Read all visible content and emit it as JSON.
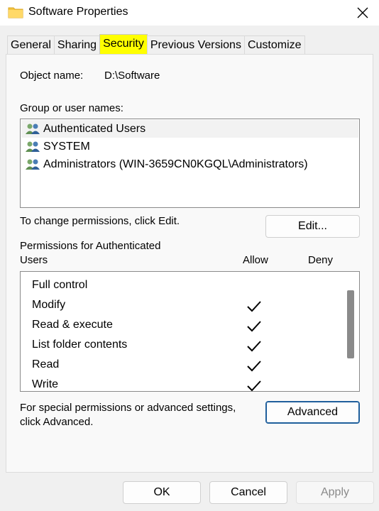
{
  "window": {
    "title": "Software Properties"
  },
  "tabs": [
    {
      "label": "General"
    },
    {
      "label": "Sharing"
    },
    {
      "label": "Security"
    },
    {
      "label": "Previous Versions"
    },
    {
      "label": "Customize"
    }
  ],
  "object": {
    "label": "Object name:",
    "value": "D:\\Software"
  },
  "groups": {
    "label": "Group or user names:",
    "items": [
      {
        "name": "Authenticated Users"
      },
      {
        "name": "SYSTEM"
      },
      {
        "name": "Administrators (WIN-3659CN0KGQL\\Administrators)"
      }
    ]
  },
  "edit": {
    "hint": "To change permissions, click Edit.",
    "button": "Edit..."
  },
  "permissions": {
    "title_line1": "Permissions for Authenticated",
    "title_line2": "Users",
    "allow_label": "Allow",
    "deny_label": "Deny",
    "rows": [
      {
        "name": "Full control",
        "allow": false
      },
      {
        "name": "Modify",
        "allow": true
      },
      {
        "name": "Read & execute",
        "allow": true
      },
      {
        "name": "List folder contents",
        "allow": true
      },
      {
        "name": "Read",
        "allow": true
      },
      {
        "name": "Write",
        "allow": true
      }
    ]
  },
  "advanced": {
    "hint_line1": "For special permissions or advanced settings,",
    "hint_line2": "click Advanced.",
    "button": "Advanced"
  },
  "footer": {
    "ok": "OK",
    "cancel": "Cancel",
    "apply": "Apply"
  },
  "colors": {
    "active_tab": "#ffff00",
    "accent_border": "#1f5f9c",
    "folder": "#f4c542"
  }
}
